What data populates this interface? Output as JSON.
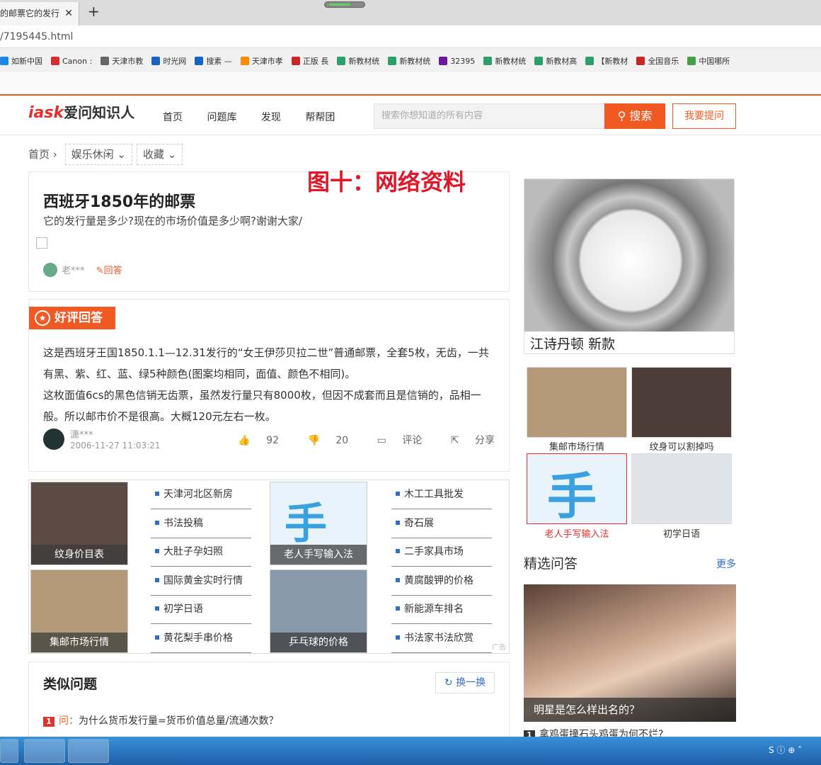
{
  "browser": {
    "tab_title": "的邮票它的发行",
    "tab_close": "✕",
    "new_tab": "+",
    "url": "/7195445.html",
    "bookmarks": [
      {
        "label": "如新中国",
        "color": "#1e88e5"
      },
      {
        "label": "Canon :",
        "color": "#d32f2f"
      },
      {
        "label": "天津市教",
        "color": "#666"
      },
      {
        "label": "时光网",
        "color": "#1565c0"
      },
      {
        "label": "搜素 —",
        "color": "#1565c0"
      },
      {
        "label": "天津市孝",
        "color": "#fb8c00"
      },
      {
        "label": "正版 長",
        "color": "#c62828"
      },
      {
        "label": "新教材统",
        "color": "#2e9e6a"
      },
      {
        "label": "新教材统",
        "color": "#2e9e6a"
      },
      {
        "label": "32395",
        "color": "#6a1b9a"
      },
      {
        "label": "新教材统",
        "color": "#2e9e6a"
      },
      {
        "label": "新教材高",
        "color": "#2e9e6a"
      },
      {
        "label": "【新教材",
        "color": "#2e9e6a"
      },
      {
        "label": "全国音乐",
        "color": "#c62828"
      },
      {
        "label": "中国哪所",
        "color": "#43a047"
      }
    ]
  },
  "site": {
    "logo_main": "iask",
    "logo_sub": "爱问知识人",
    "nav": [
      "首页",
      "问题库",
      "发现",
      "帮帮团"
    ],
    "search_placeholder": "搜索你想知道的所有内容",
    "search_button": "搜索",
    "ask_button": "我要提问"
  },
  "breadcrumb": {
    "home": "首页",
    "category": "娱乐休闲",
    "fav": "收藏"
  },
  "annotation": "图十：网络资料",
  "question": {
    "title": "西班牙1850年的邮票",
    "desc": "它的发行量是多少?现在的市场价值是多少啊?谢谢大家/",
    "user": "老***",
    "answer_link": "回答"
  },
  "best_answer": {
    "badge": "好评回答",
    "text1": "这是西班牙王国1850.1.1—12.31发行的“女王伊莎贝拉二世”普通邮票，全套5枚，无齿，一共有黑、紫、红、蓝、绿5种颜色(图案均相同，面值、颜色不相同)。",
    "text2": "这枚面值6cs的黑色信销无齿票，虽然发行量只有8000枚，但因不成套而且是信销的，品相一般。所以邮市价不是很高。大概120元左右一枚。",
    "user": "潇***",
    "time": "2006-11-27 11:03:21",
    "likes": "92",
    "dislikes": "20",
    "comment": "评论",
    "share": "分享"
  },
  "ad_block": {
    "thumbs": [
      {
        "caption": "纹身价目表",
        "color": "#5b4a44"
      },
      {
        "caption": "老人手写输入法",
        "color": "#e8f3fb"
      },
      {
        "caption": "集邮市场行情",
        "color": "#b59a7a"
      },
      {
        "caption": "乒乓球的价格",
        "color": "#8899aa"
      }
    ],
    "links_left": [
      "天津河北区新房",
      "书法投稿",
      "大肚子孕妇照",
      "国际黄金实时行情",
      "初学日语",
      "黄花梨手串价格"
    ],
    "links_right": [
      "木工工具批发",
      "奇石展",
      "二手家具市场",
      "黄腐酸钾的价格",
      "新能源车排名",
      "书法家书法欣赏"
    ],
    "ad_tag": "广告"
  },
  "similar": {
    "title": "类似问题",
    "refresh": "换一换",
    "q_label": "问：",
    "q1": "为什么货币发行量=货币价值总量/流通次数？",
    "q1_num": "1"
  },
  "sidebar": {
    "watch_caption": "江诗丹顿 新款",
    "grid": [
      {
        "caption": "集邮市场行情",
        "highlight": false
      },
      {
        "caption": "纹身可以割掉吗",
        "highlight": false
      },
      {
        "caption": "老人手写输入法",
        "highlight": true
      },
      {
        "caption": "初学日语",
        "highlight": false
      }
    ],
    "featured_title": "精选问答",
    "more": "更多",
    "star_caption": "明星是怎么样出名的？",
    "next_q_num": "1",
    "next_q": "拿鸡蛋撞石头鸡蛋为何不烂?"
  },
  "taskbar": {
    "tray": "S ⓘ ⊕ ˄"
  }
}
